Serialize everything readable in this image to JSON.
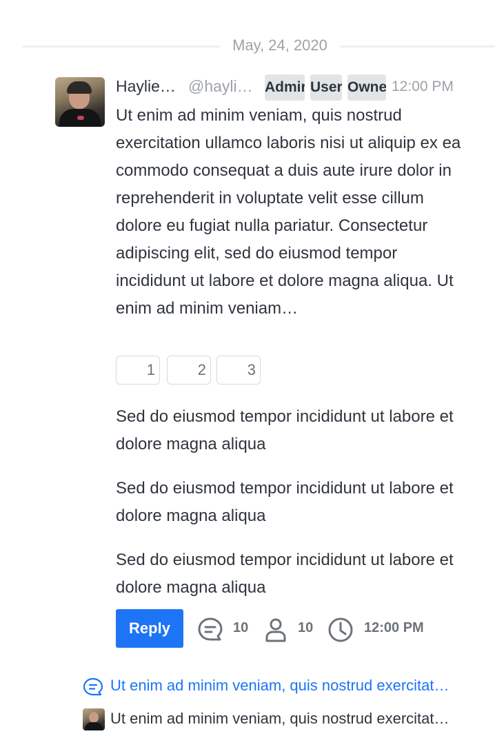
{
  "date_divider": "May, 24, 2020",
  "message": {
    "author_name": "Haylie…",
    "username": "@hayli…",
    "roles": [
      "Admir",
      "User",
      "Owne"
    ],
    "time": "12:00 PM",
    "body": "Ut enim ad minim veniam, quis nostrud exercitation ullamco laboris nisi ut aliquip ex ea commodo consequat a duis aute irure dolor in reprehenderit in voluptate velit esse cillum dolore eu fugiat nulla pariatur. Consectetur adipiscing elit, sed do eiusmod tempor incididunt ut labore et dolore magna aliqua. Ut enim ad minim veniam…",
    "reactions": [
      "1",
      "2",
      "3"
    ],
    "paragraphs": [
      "Sed do eiusmod tempor incididunt ut labore et dolore magna aliqua",
      "Sed do eiusmod tempor incididunt ut labore et dolore magna aliqua",
      "Sed do eiusmod tempor incididunt ut labore et dolore magna aliqua"
    ]
  },
  "actions": {
    "reply_label": "Reply",
    "replies_count": "10",
    "participants_count": "10",
    "last_reply_time": "12:00 PM"
  },
  "thread": {
    "preview_text": "Ut enim ad minim veniam, quis nostrud exercitat…",
    "last_reply_text": "Ut enim ad minim veniam, quis nostrud exercitat…"
  },
  "colors": {
    "accent": "#1d74f5",
    "text": "#2f343d",
    "muted": "#9ea2a8",
    "badge_bg": "#e1e5e8"
  },
  "icons": [
    "thread-icon",
    "user-icon",
    "clock-icon"
  ]
}
